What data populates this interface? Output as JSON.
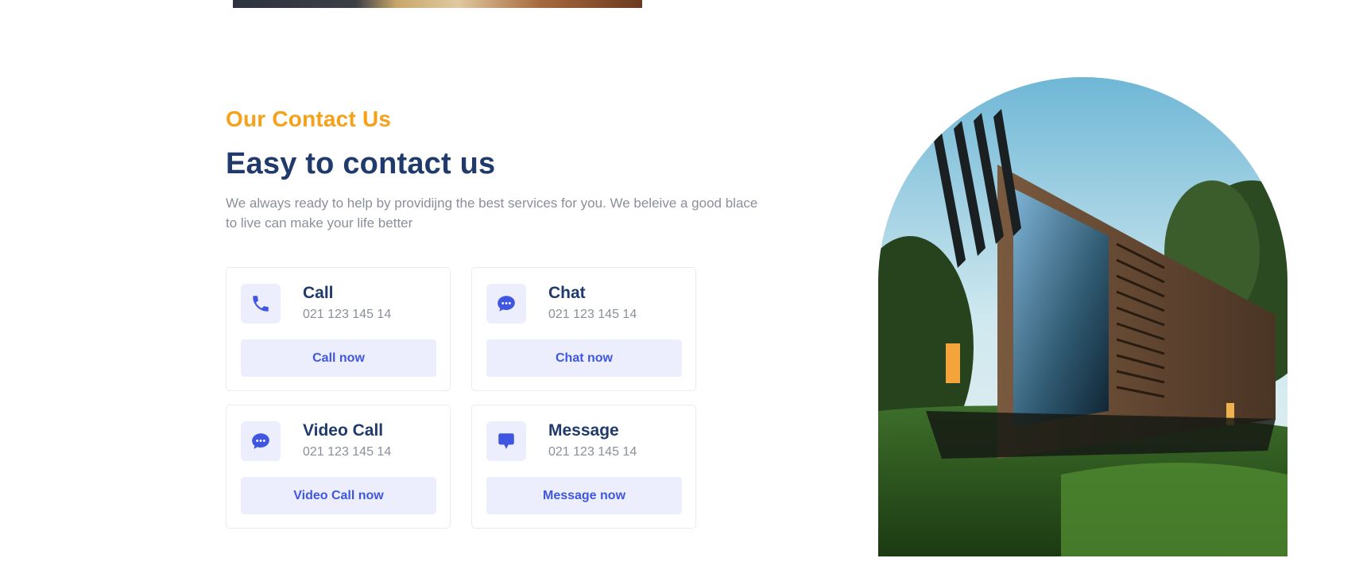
{
  "section": {
    "eyebrow": "Our Contact Us",
    "headline": "Easy to contact us",
    "description": "We always ready to help by providijng the best services for you. We beleive a good blace to live can make your life better"
  },
  "cards": [
    {
      "title": "Call",
      "phone": "021 123 145 14",
      "button": "Call now",
      "icon": "phone-icon"
    },
    {
      "title": "Chat",
      "phone": "021 123 145 14",
      "button": "Chat now",
      "icon": "chat-dots-icon"
    },
    {
      "title": "Video Call",
      "phone": "021 123 145 14",
      "button": "Video Call now",
      "icon": "chat-dots-icon"
    },
    {
      "title": "Message",
      "phone": "021 123 145 14",
      "button": "Message now",
      "icon": "message-icon"
    }
  ],
  "colors": {
    "accent_orange": "#f6a11a",
    "heading_navy": "#1f3a6b",
    "body_gray": "#8a8f99",
    "primary_blue": "#3f57e0",
    "tint_blue": "#eceefe"
  }
}
